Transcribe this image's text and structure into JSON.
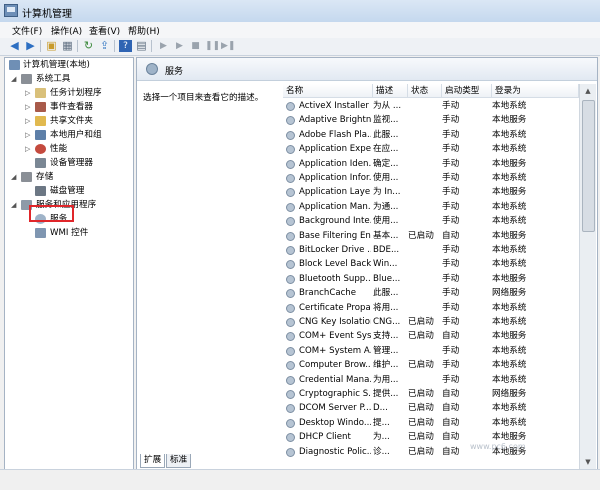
{
  "window": {
    "title": "计算机管理"
  },
  "menu": [
    "文件(F)",
    "操作(A)",
    "查看(V)",
    "帮助(H)"
  ],
  "tree": {
    "root": "计算机管理(本地)",
    "system_tools": "系统工具",
    "task_scheduler": "任务计划程序",
    "event_viewer": "事件查看器",
    "shared_folders": "共享文件夹",
    "local_users": "本地用户和组",
    "performance": "性能",
    "device_manager": "设备管理器",
    "storage": "存储",
    "disk_management": "磁盘管理",
    "services_apps": "服务和应用程序",
    "services": "服务",
    "wmi": "WMI 控件"
  },
  "main": {
    "header": "服务",
    "description_prompt": "选择一个项目来查看它的描述。",
    "columns": [
      "名称",
      "描述",
      "状态",
      "启动类型",
      "登录为"
    ]
  },
  "services": [
    [
      "ActiveX Installer ...",
      "为从 ...",
      "",
      "手动",
      "本地系统"
    ],
    [
      "Adaptive Brightn...",
      "监视...",
      "",
      "手动",
      "本地服务"
    ],
    [
      "Adobe Flash Pla...",
      "此服...",
      "",
      "手动",
      "本地系统"
    ],
    [
      "Application Expe...",
      "在应...",
      "",
      "手动",
      "本地系统"
    ],
    [
      "Application Iden...",
      "确定...",
      "",
      "手动",
      "本地服务"
    ],
    [
      "Application Infor...",
      "使用...",
      "",
      "手动",
      "本地系统"
    ],
    [
      "Application Laye...",
      "为 In...",
      "",
      "手动",
      "本地服务"
    ],
    [
      "Application Man...",
      "为通...",
      "",
      "手动",
      "本地系统"
    ],
    [
      "Background Inte...",
      "使用...",
      "",
      "手动",
      "本地系统"
    ],
    [
      "Base Filtering En...",
      "基本...",
      "已启动",
      "自动",
      "本地服务"
    ],
    [
      "BitLocker Drive ...",
      "BDE...",
      "",
      "手动",
      "本地系统"
    ],
    [
      "Block Level Back...",
      "Win...",
      "",
      "手动",
      "本地系统"
    ],
    [
      "Bluetooth Supp...",
      "Blue...",
      "",
      "手动",
      "本地服务"
    ],
    [
      "BranchCache",
      "此服...",
      "",
      "手动",
      "网络服务"
    ],
    [
      "Certificate Propa...",
      "将用...",
      "",
      "手动",
      "本地系统"
    ],
    [
      "CNG Key Isolation",
      "CNG...",
      "已启动",
      "手动",
      "本地系统"
    ],
    [
      "COM+ Event Sys...",
      "支持...",
      "已启动",
      "自动",
      "本地服务"
    ],
    [
      "COM+ System A...",
      "管理...",
      "",
      "手动",
      "本地系统"
    ],
    [
      "Computer Brow...",
      "维护...",
      "已启动",
      "手动",
      "本地系统"
    ],
    [
      "Credential Mana...",
      "为用...",
      "",
      "手动",
      "本地系统"
    ],
    [
      "Cryptographic S...",
      "提供...",
      "已启动",
      "自动",
      "网络服务"
    ],
    [
      "DCOM Server P...",
      "D...",
      "已启动",
      "自动",
      "本地系统"
    ],
    [
      "Desktop Windo...",
      "提...",
      "已启动",
      "自动",
      "本地系统"
    ],
    [
      "DHCP Client",
      "为...",
      "已启动",
      "自动",
      "本地服务"
    ],
    [
      "Diagnostic Polic...",
      "诊...",
      "已启动",
      "自动",
      "本地服务"
    ]
  ],
  "tabs": [
    "扩展",
    "标准"
  ],
  "watermark": "www.pc6.com"
}
